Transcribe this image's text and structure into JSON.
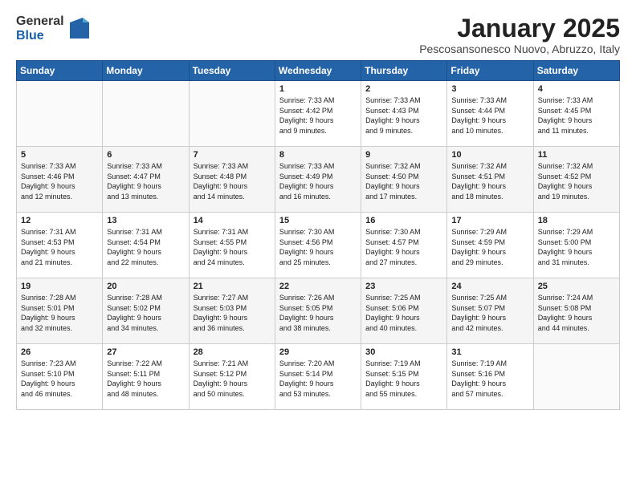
{
  "header": {
    "logo_line1": "General",
    "logo_line2": "Blue",
    "title": "January 2025",
    "subtitle": "Pescosansonesco Nuovo, Abruzzo, Italy"
  },
  "days_of_week": [
    "Sunday",
    "Monday",
    "Tuesday",
    "Wednesday",
    "Thursday",
    "Friday",
    "Saturday"
  ],
  "weeks": [
    [
      {
        "day": "",
        "info": ""
      },
      {
        "day": "",
        "info": ""
      },
      {
        "day": "",
        "info": ""
      },
      {
        "day": "1",
        "info": "Sunrise: 7:33 AM\nSunset: 4:42 PM\nDaylight: 9 hours\nand 9 minutes."
      },
      {
        "day": "2",
        "info": "Sunrise: 7:33 AM\nSunset: 4:43 PM\nDaylight: 9 hours\nand 9 minutes."
      },
      {
        "day": "3",
        "info": "Sunrise: 7:33 AM\nSunset: 4:44 PM\nDaylight: 9 hours\nand 10 minutes."
      },
      {
        "day": "4",
        "info": "Sunrise: 7:33 AM\nSunset: 4:45 PM\nDaylight: 9 hours\nand 11 minutes."
      }
    ],
    [
      {
        "day": "5",
        "info": "Sunrise: 7:33 AM\nSunset: 4:46 PM\nDaylight: 9 hours\nand 12 minutes."
      },
      {
        "day": "6",
        "info": "Sunrise: 7:33 AM\nSunset: 4:47 PM\nDaylight: 9 hours\nand 13 minutes."
      },
      {
        "day": "7",
        "info": "Sunrise: 7:33 AM\nSunset: 4:48 PM\nDaylight: 9 hours\nand 14 minutes."
      },
      {
        "day": "8",
        "info": "Sunrise: 7:33 AM\nSunset: 4:49 PM\nDaylight: 9 hours\nand 16 minutes."
      },
      {
        "day": "9",
        "info": "Sunrise: 7:32 AM\nSunset: 4:50 PM\nDaylight: 9 hours\nand 17 minutes."
      },
      {
        "day": "10",
        "info": "Sunrise: 7:32 AM\nSunset: 4:51 PM\nDaylight: 9 hours\nand 18 minutes."
      },
      {
        "day": "11",
        "info": "Sunrise: 7:32 AM\nSunset: 4:52 PM\nDaylight: 9 hours\nand 19 minutes."
      }
    ],
    [
      {
        "day": "12",
        "info": "Sunrise: 7:31 AM\nSunset: 4:53 PM\nDaylight: 9 hours\nand 21 minutes."
      },
      {
        "day": "13",
        "info": "Sunrise: 7:31 AM\nSunset: 4:54 PM\nDaylight: 9 hours\nand 22 minutes."
      },
      {
        "day": "14",
        "info": "Sunrise: 7:31 AM\nSunset: 4:55 PM\nDaylight: 9 hours\nand 24 minutes."
      },
      {
        "day": "15",
        "info": "Sunrise: 7:30 AM\nSunset: 4:56 PM\nDaylight: 9 hours\nand 25 minutes."
      },
      {
        "day": "16",
        "info": "Sunrise: 7:30 AM\nSunset: 4:57 PM\nDaylight: 9 hours\nand 27 minutes."
      },
      {
        "day": "17",
        "info": "Sunrise: 7:29 AM\nSunset: 4:59 PM\nDaylight: 9 hours\nand 29 minutes."
      },
      {
        "day": "18",
        "info": "Sunrise: 7:29 AM\nSunset: 5:00 PM\nDaylight: 9 hours\nand 31 minutes."
      }
    ],
    [
      {
        "day": "19",
        "info": "Sunrise: 7:28 AM\nSunset: 5:01 PM\nDaylight: 9 hours\nand 32 minutes."
      },
      {
        "day": "20",
        "info": "Sunrise: 7:28 AM\nSunset: 5:02 PM\nDaylight: 9 hours\nand 34 minutes."
      },
      {
        "day": "21",
        "info": "Sunrise: 7:27 AM\nSunset: 5:03 PM\nDaylight: 9 hours\nand 36 minutes."
      },
      {
        "day": "22",
        "info": "Sunrise: 7:26 AM\nSunset: 5:05 PM\nDaylight: 9 hours\nand 38 minutes."
      },
      {
        "day": "23",
        "info": "Sunrise: 7:25 AM\nSunset: 5:06 PM\nDaylight: 9 hours\nand 40 minutes."
      },
      {
        "day": "24",
        "info": "Sunrise: 7:25 AM\nSunset: 5:07 PM\nDaylight: 9 hours\nand 42 minutes."
      },
      {
        "day": "25",
        "info": "Sunrise: 7:24 AM\nSunset: 5:08 PM\nDaylight: 9 hours\nand 44 minutes."
      }
    ],
    [
      {
        "day": "26",
        "info": "Sunrise: 7:23 AM\nSunset: 5:10 PM\nDaylight: 9 hours\nand 46 minutes."
      },
      {
        "day": "27",
        "info": "Sunrise: 7:22 AM\nSunset: 5:11 PM\nDaylight: 9 hours\nand 48 minutes."
      },
      {
        "day": "28",
        "info": "Sunrise: 7:21 AM\nSunset: 5:12 PM\nDaylight: 9 hours\nand 50 minutes."
      },
      {
        "day": "29",
        "info": "Sunrise: 7:20 AM\nSunset: 5:14 PM\nDaylight: 9 hours\nand 53 minutes."
      },
      {
        "day": "30",
        "info": "Sunrise: 7:19 AM\nSunset: 5:15 PM\nDaylight: 9 hours\nand 55 minutes."
      },
      {
        "day": "31",
        "info": "Sunrise: 7:19 AM\nSunset: 5:16 PM\nDaylight: 9 hours\nand 57 minutes."
      },
      {
        "day": "",
        "info": ""
      }
    ]
  ]
}
